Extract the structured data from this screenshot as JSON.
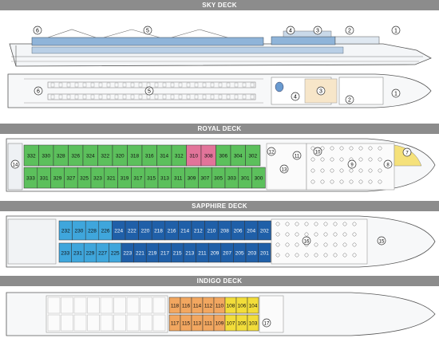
{
  "decks": {
    "sky": {
      "title": "SKY DECK"
    },
    "royal": {
      "title": "ROYAL DECK"
    },
    "sapphire": {
      "title": "SAPPHIRE DECK"
    },
    "indigo": {
      "title": "INDIGO DECK"
    }
  },
  "markers": {
    "m1": "1",
    "m2": "2",
    "m3": "3",
    "m4": "4",
    "m5": "5",
    "m6": "6",
    "m7": "7",
    "m8": "8",
    "m9": "9",
    "m10": "10",
    "m11": "11",
    "m12": "12",
    "m13": "13",
    "m14": "14",
    "m15": "15",
    "m16": "16",
    "m17": "17"
  },
  "colors": {
    "green": "#5cc05c",
    "pink": "#e2749a",
    "blue": "#1f5fa8",
    "light_blue": "#3fa6dc",
    "orange": "#f2a760",
    "yellow": "#f2dd3a",
    "lounge": "#f7e6c9",
    "band": "#8c8c8c"
  },
  "royal_cabins": {
    "top": [
      {
        "n": "332",
        "c": "green"
      },
      {
        "n": "330",
        "c": "green"
      },
      {
        "n": "328",
        "c": "green"
      },
      {
        "n": "326",
        "c": "green"
      },
      {
        "n": "324",
        "c": "green"
      },
      {
        "n": "322",
        "c": "green"
      },
      {
        "n": "320",
        "c": "green"
      },
      {
        "n": "318",
        "c": "green"
      },
      {
        "n": "316",
        "c": "green"
      },
      {
        "n": "314",
        "c": "green"
      },
      {
        "n": "312",
        "c": "green"
      },
      {
        "n": "310",
        "c": "pink"
      },
      {
        "n": "308",
        "c": "pink"
      },
      {
        "n": "306",
        "c": "green"
      },
      {
        "n": "304",
        "c": "green"
      },
      {
        "n": "302",
        "c": "green"
      }
    ],
    "bottom": [
      {
        "n": "333",
        "c": "green"
      },
      {
        "n": "331",
        "c": "green"
      },
      {
        "n": "329",
        "c": "green"
      },
      {
        "n": "327",
        "c": "green"
      },
      {
        "n": "325",
        "c": "green"
      },
      {
        "n": "323",
        "c": "green"
      },
      {
        "n": "321",
        "c": "green"
      },
      {
        "n": "319",
        "c": "green"
      },
      {
        "n": "317",
        "c": "green"
      },
      {
        "n": "315",
        "c": "green"
      },
      {
        "n": "313",
        "c": "green"
      },
      {
        "n": "311",
        "c": "green"
      },
      {
        "n": "309",
        "c": "green"
      },
      {
        "n": "307",
        "c": "green"
      },
      {
        "n": "305",
        "c": "green"
      },
      {
        "n": "303",
        "c": "green"
      },
      {
        "n": "301",
        "c": "green"
      },
      {
        "n": "300",
        "c": "green"
      }
    ]
  },
  "sapphire_cabins": {
    "top": [
      {
        "n": "232",
        "c": "light_blue"
      },
      {
        "n": "230",
        "c": "light_blue"
      },
      {
        "n": "228",
        "c": "light_blue"
      },
      {
        "n": "226",
        "c": "light_blue"
      },
      {
        "n": "224",
        "c": "blue"
      },
      {
        "n": "222",
        "c": "blue"
      },
      {
        "n": "220",
        "c": "blue"
      },
      {
        "n": "218",
        "c": "blue"
      },
      {
        "n": "216",
        "c": "blue"
      },
      {
        "n": "214",
        "c": "blue"
      },
      {
        "n": "212",
        "c": "blue"
      },
      {
        "n": "210",
        "c": "blue"
      },
      {
        "n": "208",
        "c": "blue"
      },
      {
        "n": "206",
        "c": "blue"
      },
      {
        "n": "204",
        "c": "blue"
      },
      {
        "n": "202",
        "c": "blue"
      }
    ],
    "bottom": [
      {
        "n": "233",
        "c": "light_blue"
      },
      {
        "n": "231",
        "c": "light_blue"
      },
      {
        "n": "229",
        "c": "light_blue"
      },
      {
        "n": "227",
        "c": "light_blue"
      },
      {
        "n": "225",
        "c": "light_blue"
      },
      {
        "n": "223",
        "c": "blue"
      },
      {
        "n": "221",
        "c": "blue"
      },
      {
        "n": "219",
        "c": "blue"
      },
      {
        "n": "217",
        "c": "blue"
      },
      {
        "n": "215",
        "c": "blue"
      },
      {
        "n": "213",
        "c": "blue"
      },
      {
        "n": "211",
        "c": "blue"
      },
      {
        "n": "209",
        "c": "blue"
      },
      {
        "n": "207",
        "c": "blue"
      },
      {
        "n": "205",
        "c": "blue"
      },
      {
        "n": "203",
        "c": "blue"
      },
      {
        "n": "201",
        "c": "blue"
      }
    ]
  },
  "indigo_cabins": {
    "top": [
      {
        "n": "118",
        "c": "orange"
      },
      {
        "n": "116",
        "c": "orange"
      },
      {
        "n": "114",
        "c": "orange"
      },
      {
        "n": "112",
        "c": "orange"
      },
      {
        "n": "110",
        "c": "orange"
      },
      {
        "n": "108",
        "c": "yellow"
      },
      {
        "n": "106",
        "c": "yellow"
      },
      {
        "n": "104",
        "c": "yellow"
      }
    ],
    "bottom": [
      {
        "n": "117",
        "c": "orange"
      },
      {
        "n": "115",
        "c": "orange"
      },
      {
        "n": "113",
        "c": "orange"
      },
      {
        "n": "111",
        "c": "orange"
      },
      {
        "n": "109",
        "c": "orange"
      },
      {
        "n": "107",
        "c": "yellow"
      },
      {
        "n": "105",
        "c": "yellow"
      },
      {
        "n": "103",
        "c": "yellow"
      }
    ]
  }
}
